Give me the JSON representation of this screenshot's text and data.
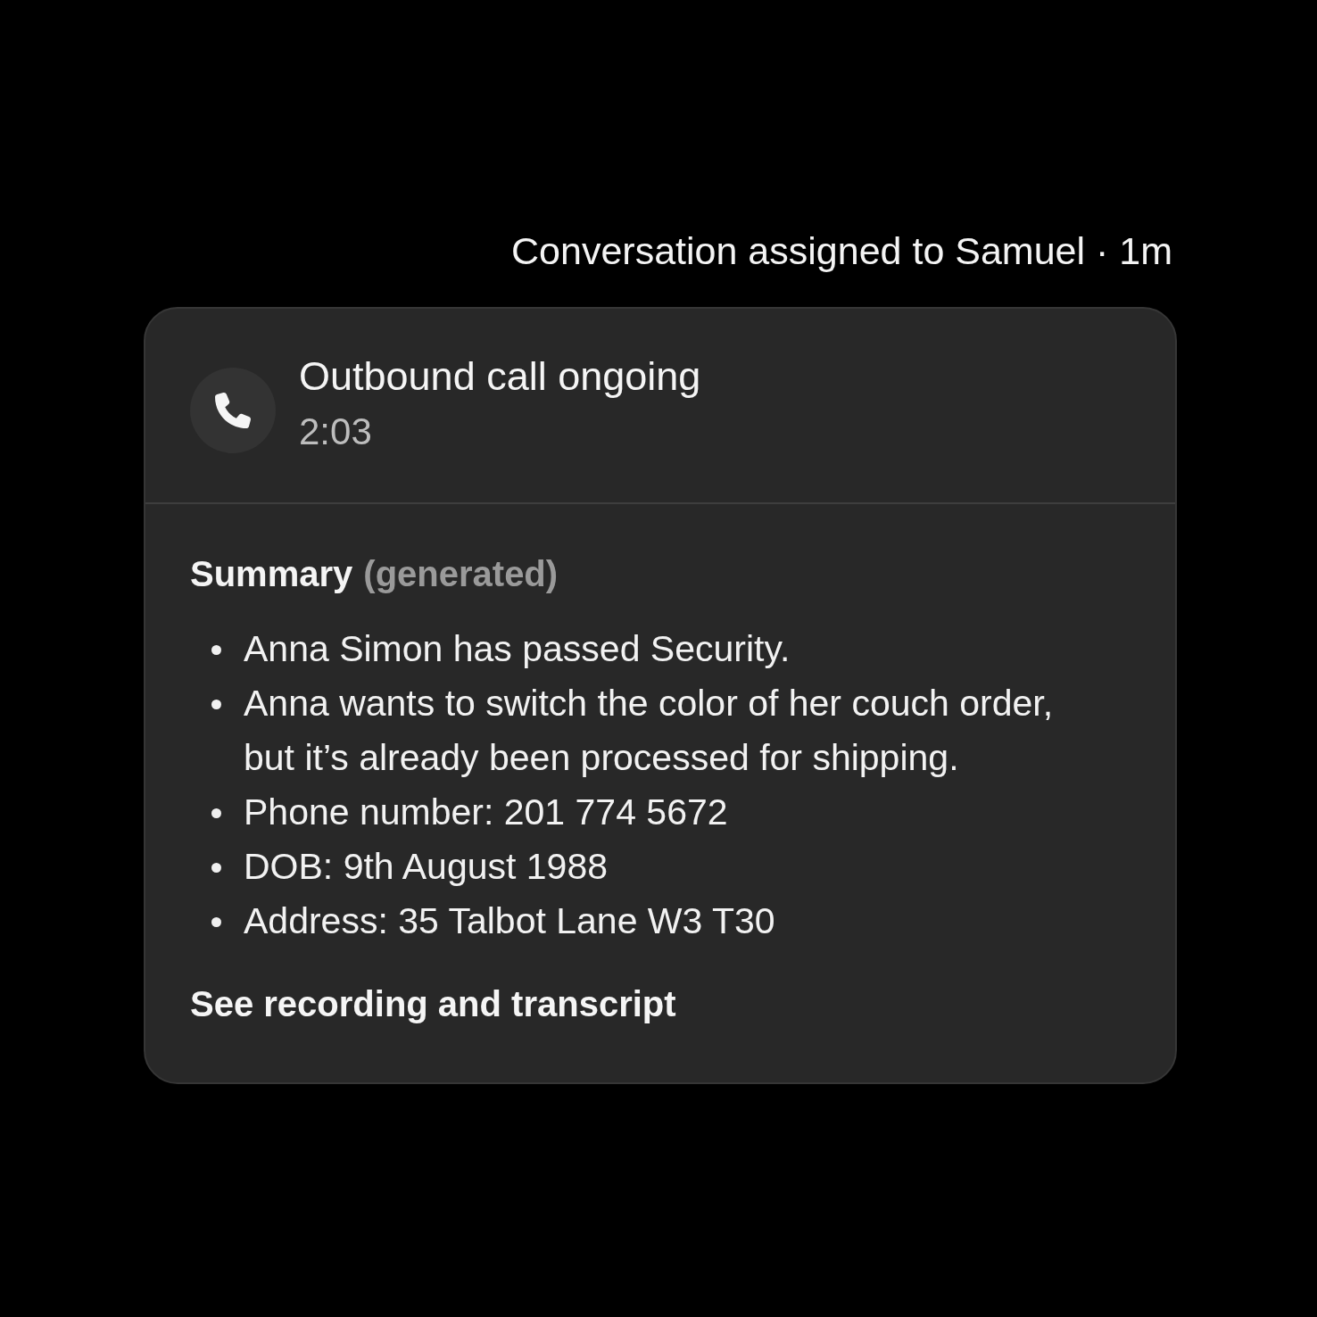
{
  "assignment": {
    "text": "Conversation assigned to Samuel · 1m"
  },
  "call": {
    "title": "Outbound call ongoing",
    "duration": "2:03"
  },
  "summary": {
    "title": "Summary",
    "note": "(generated)",
    "items": [
      "Anna Simon has passed Security.",
      "Anna wants to switch the color of her couch order, but it’s already been processed for shipping.",
      "Phone number: 201 774 5672",
      "DOB: 9th August 1988",
      "Address: 35 Talbot Lane W3 T30"
    ]
  },
  "link": {
    "label": "See recording and transcript"
  }
}
